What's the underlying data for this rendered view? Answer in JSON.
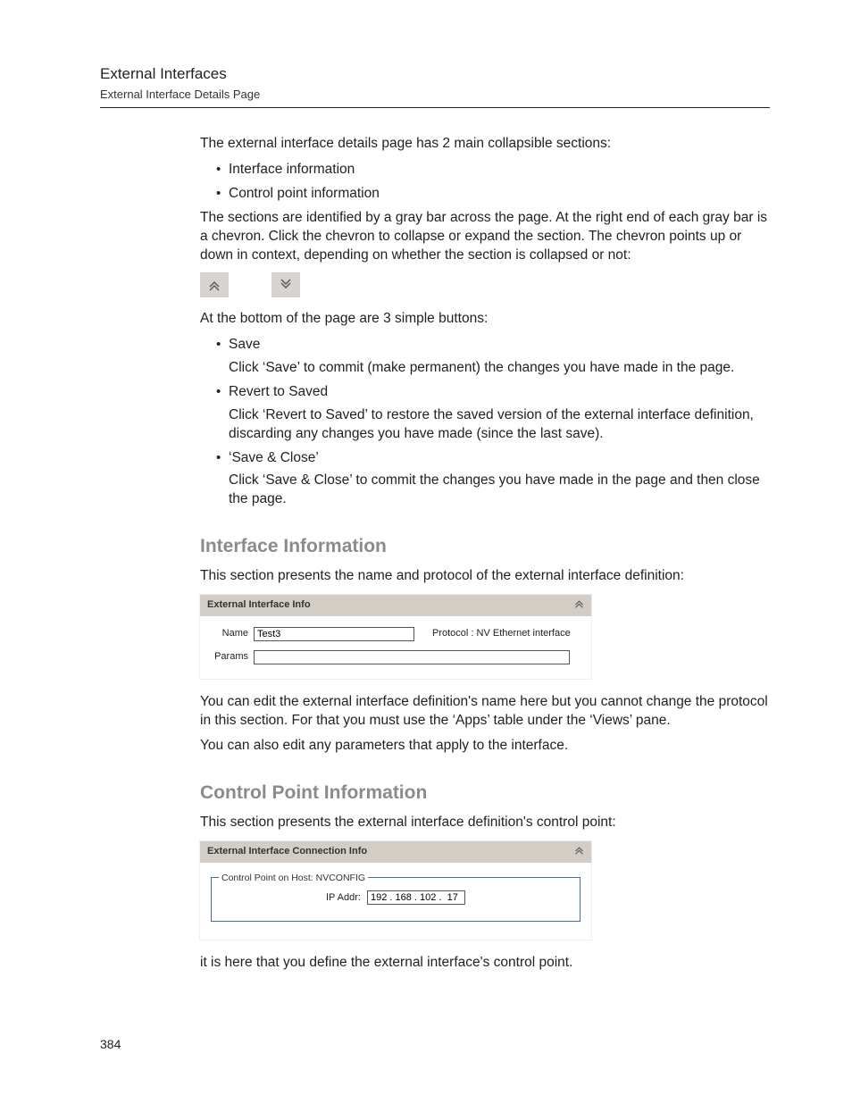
{
  "header": {
    "title": "External Interfaces",
    "subtitle": "External Interface Details Page"
  },
  "intro": "The external interface details page has 2 main collapsible sections:",
  "intro_bullets": [
    "Interface information",
    "Control point information"
  ],
  "sections_text": "The sections are identified by a gray bar across the page. At the right end of each gray bar is a chevron. Click the chevron to collapse or expand the section. The chevron points up or down in context, depending on whether the section is collapsed or not:",
  "bottom_intro": "At the bottom of the page are 3 simple buttons:",
  "buttons": [
    {
      "name": "Save",
      "desc": "Click ‘Save’ to commit (make permanent) the changes you have made in the page."
    },
    {
      "name": "Revert to Saved",
      "desc": "Click ‘Revert to Saved’ to restore the saved version of the external interface definition, discarding any changes you have made (since the last save)."
    },
    {
      "name": "‘Save & Close’",
      "desc": "Click ‘Save & Close’ to commit the changes you have made in the page and then close the page."
    }
  ],
  "sec1": {
    "heading": "Interface Information",
    "lead": "This section presents the name and protocol of the external interface definition:",
    "panel_title": "External Interface Info",
    "name_label": "Name",
    "name_value": "Test3",
    "protocol_label": "Protocol :",
    "protocol_value": "NV Ethernet interface",
    "params_label": "Params",
    "params_value": "",
    "after1": "You can edit the external interface definition's name here but you cannot change the protocol in this section. For that you must use the ‘Apps’ table under the ‘Views’ pane.",
    "after2": "You can also edit any parameters that apply to the interface."
  },
  "sec2": {
    "heading": "Control Point Information",
    "lead": "This section presents the external interface definition's control point:",
    "panel_title": "External Interface Connection Info",
    "fieldset_legend": "Control Point on Host: NVCONFIG",
    "ip_label": "IP Addr:",
    "ip_value": "192 . 168 . 102 .  17",
    "after": "it is here that you define the external interface's control point."
  },
  "page_number": "384"
}
